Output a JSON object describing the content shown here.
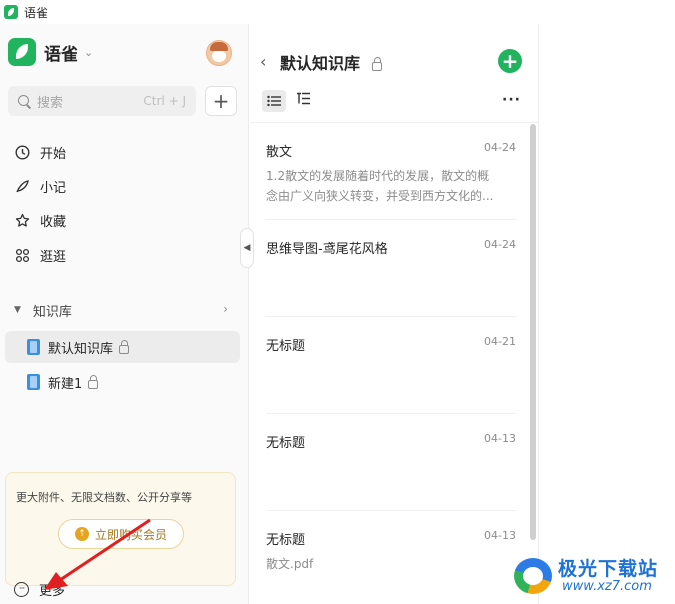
{
  "window": {
    "title": "语雀"
  },
  "sidebar": {
    "brand": "语雀",
    "search": {
      "placeholder": "搜索",
      "shortcut": "Ctrl + J"
    },
    "add_label": "+",
    "nav": [
      {
        "label": "开始",
        "icon": "clock-icon"
      },
      {
        "label": "小记",
        "icon": "feather-icon"
      },
      {
        "label": "收藏",
        "icon": "star-icon"
      },
      {
        "label": "逛逛",
        "icon": "grid-icon"
      }
    ],
    "knowledge_base": {
      "header": "知识库",
      "items": [
        {
          "label": "默认知识库",
          "locked": true,
          "active": true
        },
        {
          "label": "新建1",
          "locked": true,
          "active": false
        }
      ]
    },
    "promo": {
      "text": "更大附件、无限文档数、公开分享等",
      "button": "立即购买会员"
    },
    "more": "更多"
  },
  "panel": {
    "title": "默认知识库",
    "new_label": "+",
    "more_label": "···",
    "docs": [
      {
        "title": "散文",
        "date": "04-24",
        "snippet": [
          "1.2散文的发展随着时代的发展，散文的概",
          "念由广义向狭义转变，并受到西方文化的..."
        ]
      },
      {
        "title": "思维导图-鸢尾花风格",
        "date": "04-24",
        "snippet": []
      },
      {
        "title": "无标题",
        "date": "04-21",
        "snippet": []
      },
      {
        "title": "无标题",
        "date": "04-13",
        "snippet": []
      },
      {
        "title": "无标题",
        "date": "04-13",
        "snippet": [
          "散文.pdf"
        ]
      }
    ]
  },
  "watermark": {
    "name": "极光下载站",
    "url": "www.xz7.com"
  },
  "colors": {
    "brand_green": "#22b35e",
    "annotation_red": "#e02020",
    "watermark_blue": "#1d72d4"
  }
}
